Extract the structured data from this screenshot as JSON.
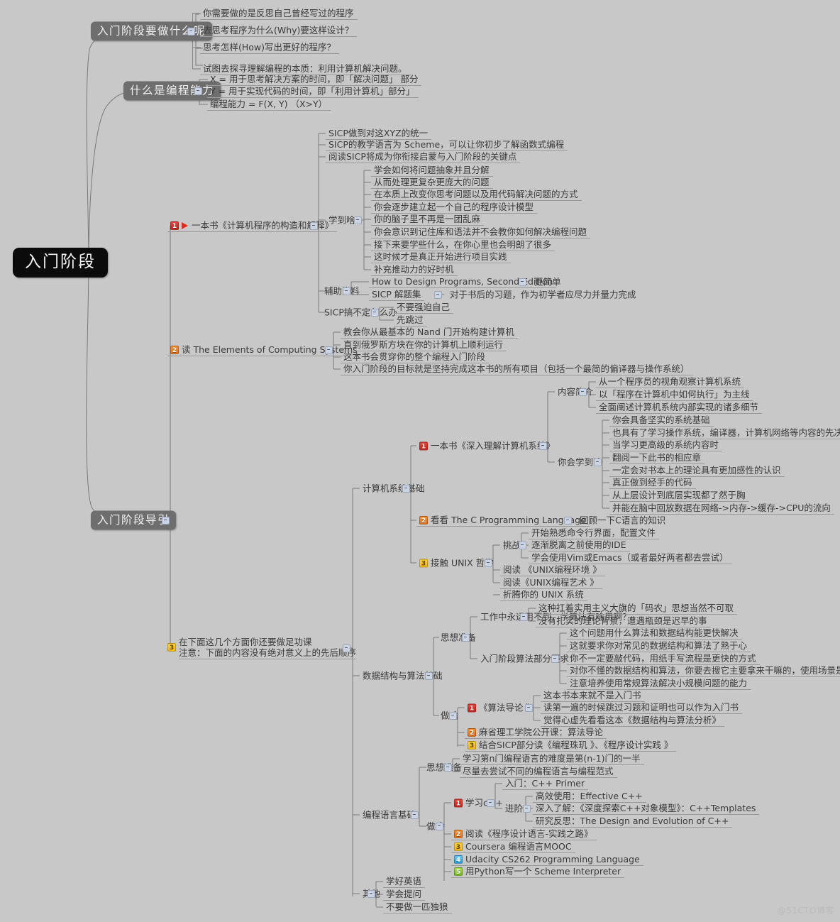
{
  "title": "入门阶段",
  "watermark": "@51CTO博客",
  "colors": {
    "background": "#c8c8c8",
    "root_bg": "#0b0b0b",
    "pill_bg": "#6e6e6e",
    "line": "#7a7a7a",
    "badge1": "#d6302a",
    "badge2": "#ee8228",
    "badge3": "#f5c41f",
    "badge4": "#45b0e0",
    "badge5": "#8ccd35",
    "flag": "#dd2b20"
  },
  "root": {
    "label": "入门阶段"
  },
  "branches": {
    "b1": {
      "label": "入门阶段要做什么呢",
      "children": [
        "你需要做的是反思自己曾经写过的程序",
        "去思考程序为什么(Why)要这样设计？",
        "思考怎样(How)写出更好的程序？",
        "试图去探寻理解编程的本质：利用计算机解决问题。"
      ]
    },
    "b2": {
      "label": "什么是编程能力",
      "children": [
        "X = 用于思考解决方案的时间，即「解决问题」 部分",
        "Y = 用于实现代码的时间，即「利用计算机」部分」",
        "编程能力 = F(X, Y) （X>Y）"
      ]
    },
    "b3": {
      "label": "入门阶段导引",
      "items": {
        "sicp": {
          "badge": "1",
          "flag": true,
          "label": "一本书《计算机程序的构造和解释》",
          "direct": [
            "SICP做到对这XYZ的统一",
            "SICP的教学语言为 Scheme，可以让你初步了解函数式编程",
            "阅读SICP将成为你衔接启蒙与入门阶段的关键点"
          ],
          "groups": [
            {
              "label": "学到啥",
              "children": [
                "学会如何将问题抽象并且分解",
                "从而处理更复杂更庞大的问题",
                "在本质上改变你思考问题以及用代码解决问题的方式",
                "你会逐步建立起一个自己的程序设计模型",
                "你的脑子里不再是一团乱麻",
                "你会意识到记住库和语法并不会教你如何解决编程问题",
                "接下来要学些什么，在你心里也会明朗了很多",
                "这时候才是真正开始进行项目实践",
                "补充推动力的好时机"
              ]
            },
            {
              "label": "辅助资料",
              "children": [
                {
                  "label": "How to Design Programs, Second Edition",
                  "note": "更简单"
                },
                {
                  "label": "SICP 解题集",
                  "note": "对于书后的习题，作为初学者应尽力并量力完成"
                }
              ]
            },
            {
              "label": "SICP搞不定怎么办",
              "children": [
                "不要强迫自己",
                "先跳过"
              ]
            }
          ]
        },
        "tecs": {
          "badge": "2",
          "label": "读 The Elements of Computing Systems",
          "children": [
            "教会你从最基本的 Nand 门开始构建计算机",
            "直到俄罗斯方块在你的计算机上顺利运行",
            "这本书会贯穿你的整个编程入门阶段",
            "你入门阶段的目标就是坚持完成这本书的所有项目（包括一个最简的偏译器与操作系统）"
          ]
        },
        "homework": {
          "badge": "3",
          "label_line1": "在下面这几个方面你还要做足功课",
          "label_line2": "注意：下面的内容没有绝对意义上的先后顺序",
          "sections": [
            {
              "label": "计算机系统基础",
              "items": [
                {
                  "badge": "1",
                  "label": "一本书《深入理解计算机系统》",
                  "groups": [
                    {
                      "label": "内容简介",
                      "children": [
                        "从一个程序员的视角观察计算机系统",
                        "以「程序在计算机中如何执行」为主线",
                        "全面阐述计算机系统内部实现的诸多细节"
                      ]
                    },
                    {
                      "label": "你会学到啥",
                      "children": [
                        "你会具备坚实的系统基础",
                        "也具有了学习操作系统，编译器，计算机网络等内容的先决条件",
                        "当学习更高级的系统内容时",
                        "翻阅一下此书的相应章",
                        "一定会对书本上的理论具有更加感性的认识",
                        "真正做到经手的代码",
                        "从上层设计到底层实现都了然于胸",
                        "并能在脑中回放数据在网络->内存->缓存->CPU的流向"
                      ]
                    }
                  ]
                },
                {
                  "badge": "2",
                  "label": "看看 The C Programming Language",
                  "note": "回顾一下C语言的知识"
                },
                {
                  "badge": "3",
                  "label": "接触 UNIX 哲学",
                  "groups": [
                    {
                      "label": "挑战",
                      "children": [
                        "开始熟悉命令行界面，配置文件",
                        "逐渐脱离之前使用的IDE",
                        "学会使用Vim或Emacs（或者最好两者都去尝试）"
                      ]
                    }
                  ],
                  "children": [
                    "阅读 《UNIX编程环境 》",
                    "阅读《UNIX编程艺术 》",
                    "折腾你的 UNIX 系统"
                  ]
                }
              ]
            },
            {
              "label": "数据结构与算法基础",
              "groups": [
                {
                  "label": "思想准备",
                  "subgroups": [
                    {
                      "label": "工作中永远用不到，学算法有啥用啊？",
                      "children": [
                        "这种扛着实用主义大旗的「码农」思想当然不可取",
                        "没有扎实的理论背景，遭遇瓶颈是迟早的事"
                      ]
                    },
                    {
                      "label": "入门阶段算法部分要求",
                      "children": [
                        "这个问题用什么算法和数据结构能更快解决",
                        "这就要求你对常见的数据结构和算法了熟于心",
                        "你不一定要敲代码，用纸手写流程是更快的方式",
                        "对你不懂的数据结构和算法，你要去搜它主要拿来干嘛的，使用场景是什么",
                        "注意培养使用常规算法解决小规模问题的能力"
                      ]
                    }
                  ]
                },
                {
                  "label": "做啥",
                  "items": [
                    {
                      "badge": "1",
                      "label": "《算法导论 》",
                      "children": [
                        "这本书本来就不是入门书",
                        "读第一遍的时候跳过习题和证明也可以作为入门书",
                        "觉得心虚先看看这本《数据结构与算法分析》"
                      ]
                    },
                    {
                      "badge": "2",
                      "label": "麻省理工学院公开课：算法导论"
                    },
                    {
                      "badge": "3",
                      "label": "结合SICP部分读《编程珠玑 》、《程序设计实践 》"
                    }
                  ]
                }
              ]
            },
            {
              "label": "编程语言基础",
              "groups": [
                {
                  "label": "思想准备",
                  "children": [
                    "学习第n门编程语言的难度是第(n-1)门的一半",
                    "尽量去尝试不同的编程语言与编程范式"
                  ]
                },
                {
                  "label": "做啥",
                  "items": [
                    {
                      "badge": "1",
                      "label": "学习c++",
                      "children": [
                        "入门：C++ Primer"
                      ],
                      "groups": [
                        {
                          "label": "进阶",
                          "children": [
                            "高效使用：Effective C++",
                            "深入了解：《深度探索C++对象模型》：C++Templates",
                            "研究反思：The Design and Evolution of C++"
                          ]
                        }
                      ]
                    },
                    {
                      "badge": "2",
                      "label": "阅读《程序设计语言-实践之路》"
                    },
                    {
                      "badge": "3",
                      "label": "Coursera 编程语言MOOC"
                    },
                    {
                      "badge": "4",
                      "label": "Udacity CS262 Programming Language"
                    },
                    {
                      "badge": "5",
                      "label": "用Python写一个 Scheme Interpreter"
                    }
                  ]
                }
              ]
            },
            {
              "label": "其他",
              "children": [
                "学好英语",
                "学会提问",
                "不要做一匹独狼"
              ]
            }
          ]
        }
      }
    }
  }
}
